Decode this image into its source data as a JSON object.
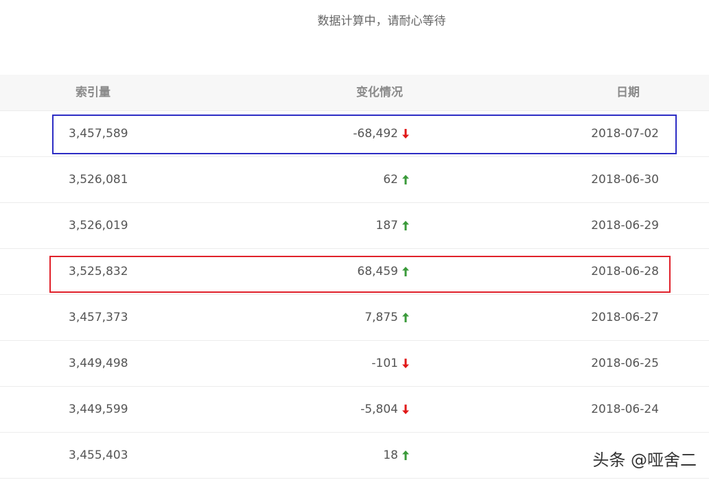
{
  "status_text": "数据计算中，请耐心等待",
  "table": {
    "headers": {
      "index": "索引量",
      "change": "变化情况",
      "date": "日期"
    },
    "rows": [
      {
        "index": "3,457,589",
        "change": "-68,492",
        "direction": "down",
        "date": "2018-07-02"
      },
      {
        "index": "3,526,081",
        "change": "62",
        "direction": "up",
        "date": "2018-06-30"
      },
      {
        "index": "3,526,019",
        "change": "187",
        "direction": "up",
        "date": "2018-06-29"
      },
      {
        "index": "3,525,832",
        "change": "68,459",
        "direction": "up",
        "date": "2018-06-28"
      },
      {
        "index": "3,457,373",
        "change": "7,875",
        "direction": "up",
        "date": "2018-06-27"
      },
      {
        "index": "3,449,498",
        "change": "-101",
        "direction": "down",
        "date": "2018-06-25"
      },
      {
        "index": "3,449,599",
        "change": "-5,804",
        "direction": "down",
        "date": "2018-06-24"
      },
      {
        "index": "3,455,403",
        "change": "18",
        "direction": "up",
        "date": ""
      }
    ]
  },
  "colors": {
    "up": "#3a9a3a",
    "down": "#e01818",
    "highlight_blue": "#2c2cc4",
    "highlight_red": "#e0202a"
  },
  "icons": {
    "up": "arrow-up-icon",
    "down": "arrow-down-icon"
  },
  "watermark": "头条 @哑舍二"
}
